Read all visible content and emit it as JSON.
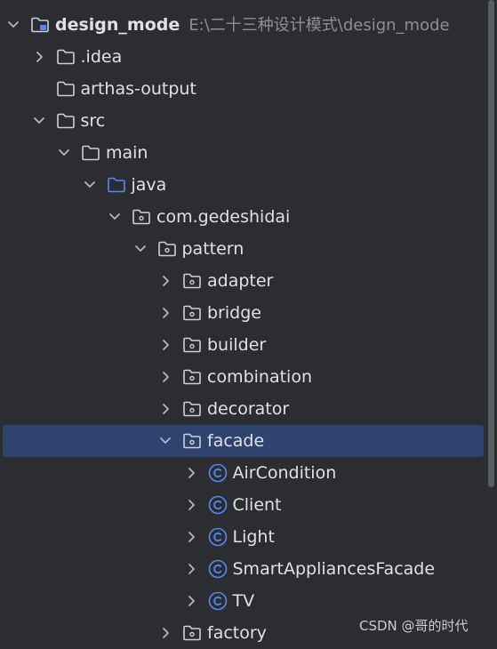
{
  "project": {
    "name": "design_mode",
    "path": "E:\\二十三种设计模式\\design_mode"
  },
  "tree": [
    {
      "label": "design_mode",
      "indent": 0,
      "chevron": "down",
      "icon": "module-folder-icon",
      "bold": true,
      "path": "E:\\二十三种设计模式\\design_mode"
    },
    {
      "label": ".idea",
      "indent": 1,
      "chevron": "right",
      "icon": "folder-icon"
    },
    {
      "label": "arthas-output",
      "indent": 1,
      "chevron": "none",
      "icon": "folder-icon"
    },
    {
      "label": "src",
      "indent": 1,
      "chevron": "down",
      "icon": "folder-icon"
    },
    {
      "label": "main",
      "indent": 2,
      "chevron": "down",
      "icon": "folder-icon"
    },
    {
      "label": "java",
      "indent": 3,
      "chevron": "down",
      "icon": "source-folder-icon"
    },
    {
      "label": "com.gedeshidai",
      "indent": 4,
      "chevron": "down",
      "icon": "package-icon"
    },
    {
      "label": "pattern",
      "indent": 5,
      "chevron": "down",
      "icon": "package-icon"
    },
    {
      "label": "adapter",
      "indent": 6,
      "chevron": "right",
      "icon": "package-icon"
    },
    {
      "label": "bridge",
      "indent": 6,
      "chevron": "right",
      "icon": "package-icon"
    },
    {
      "label": "builder",
      "indent": 6,
      "chevron": "right",
      "icon": "package-icon"
    },
    {
      "label": "combination",
      "indent": 6,
      "chevron": "right",
      "icon": "package-icon"
    },
    {
      "label": "decorator",
      "indent": 6,
      "chevron": "right",
      "icon": "package-icon"
    },
    {
      "label": "facade",
      "indent": 6,
      "chevron": "down",
      "icon": "package-icon",
      "selected": true
    },
    {
      "label": "AirCondition",
      "indent": 7,
      "chevron": "right",
      "icon": "class-icon"
    },
    {
      "label": "Client",
      "indent": 7,
      "chevron": "right",
      "icon": "class-icon"
    },
    {
      "label": "Light",
      "indent": 7,
      "chevron": "right",
      "icon": "class-icon"
    },
    {
      "label": "SmartAppliancesFacade",
      "indent": 7,
      "chevron": "right",
      "icon": "class-icon"
    },
    {
      "label": "TV",
      "indent": 7,
      "chevron": "right",
      "icon": "class-icon"
    },
    {
      "label": "factory",
      "indent": 6,
      "chevron": "right",
      "icon": "package-icon"
    }
  ],
  "watermark": "CSDN @哥的时代",
  "colors": {
    "background": "#2b2d30",
    "selection": "#2e436e",
    "text": "#dfe1e5",
    "path": "#8c8f94",
    "class_icon": "#548af7",
    "source_folder": "#548af7"
  }
}
